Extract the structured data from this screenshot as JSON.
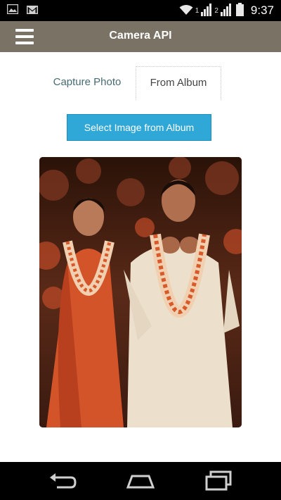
{
  "status_bar": {
    "left_icons": [
      "image-icon",
      "gmail-icon"
    ],
    "right_icons": [
      "wifi-icon",
      "signal-1-icon",
      "signal-2-icon",
      "battery-icon"
    ],
    "sim1_label": "1",
    "sim2_label": "2",
    "time": "9:37"
  },
  "header": {
    "title": "Camera API",
    "menu_icon": "hamburger-menu-icon"
  },
  "tabs": [
    {
      "label": "Capture Photo",
      "active": false
    },
    {
      "label": "From Album",
      "active": true
    }
  ],
  "select_button": {
    "label": "Select Image from Album"
  },
  "selected_image": {
    "description_icon": "selected-photo"
  },
  "nav_bar": {
    "icons": [
      "back-icon",
      "home-icon",
      "recent-apps-icon"
    ]
  },
  "colors": {
    "header_bg": "#7a7264",
    "button_bg": "#2fa8d8",
    "tab_inactive_text": "#466b73"
  }
}
